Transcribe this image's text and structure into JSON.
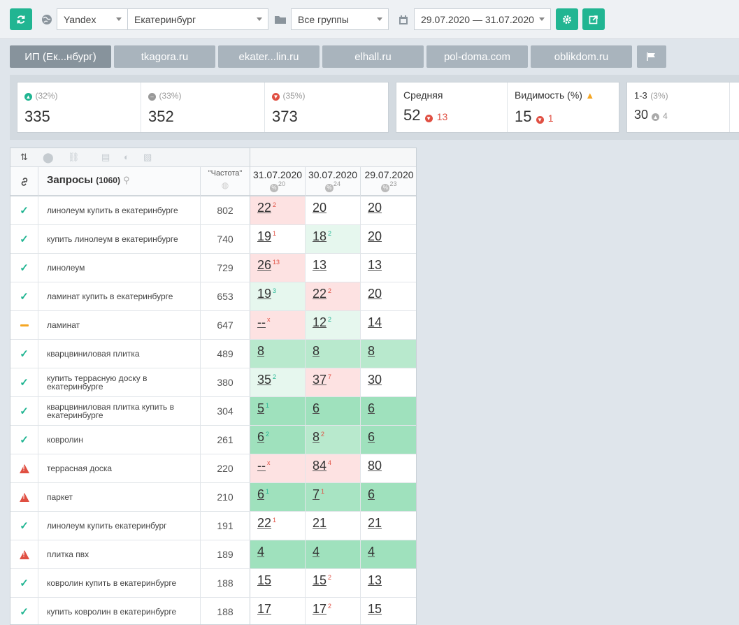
{
  "toolbar": {
    "engine": "Yandex",
    "region": "Екатеринбург",
    "group": "Все группы",
    "dates": "29.07.2020 — 31.07.2020"
  },
  "tabs": [
    "ИП (Ек...нбург)",
    "tkagora.ru",
    "ekater...lin.ru",
    "elhall.ru",
    "pol-doma.com",
    "oblikdom.ru"
  ],
  "stats": {
    "up": {
      "pct": "(32%)",
      "val": "335"
    },
    "same": {
      "pct": "(33%)",
      "val": "352"
    },
    "down": {
      "pct": "(35%)",
      "val": "373"
    },
    "avg": {
      "label": "Средняя",
      "val": "52",
      "delta": "13"
    },
    "vis": {
      "label": "Видимость (%)",
      "val": "15",
      "delta": "1"
    },
    "top": {
      "label": "1-3",
      "pct": "(3%)",
      "val": "30",
      "delta": "4"
    }
  },
  "table": {
    "queries_label": "Запросы",
    "queries_count": "(1060)",
    "freq_label": "\"Частота\"",
    "dates": [
      {
        "d": "31.07.2020",
        "p": "20"
      },
      {
        "d": "30.07.2020",
        "p": "24"
      },
      {
        "d": "29.07.2020",
        "p": "23"
      }
    ],
    "rows": [
      {
        "s": "ok",
        "q": "линолеум купить в екатеринбурге",
        "f": "802",
        "c": [
          {
            "v": "22",
            "d": "2",
            "t": "r",
            "b": "bg-red"
          },
          {
            "v": "20",
            "d": "",
            "t": "",
            "b": ""
          },
          {
            "v": "20",
            "d": "",
            "t": "",
            "b": ""
          }
        ]
      },
      {
        "s": "ok",
        "q": "купить линолеум в екатеринбурге",
        "f": "740",
        "c": [
          {
            "v": "19",
            "d": "1",
            "t": "r",
            "b": ""
          },
          {
            "v": "18",
            "d": "2",
            "t": "g",
            "b": "bg-lg"
          },
          {
            "v": "20",
            "d": "",
            "t": "",
            "b": ""
          }
        ]
      },
      {
        "s": "ok",
        "q": "линолеум",
        "f": "729",
        "c": [
          {
            "v": "26",
            "d": "13",
            "t": "r",
            "b": "bg-red"
          },
          {
            "v": "13",
            "d": "",
            "t": "",
            "b": ""
          },
          {
            "v": "13",
            "d": "",
            "t": "",
            "b": ""
          }
        ]
      },
      {
        "s": "ok",
        "q": "ламинат купить в екатеринбурге",
        "f": "653",
        "c": [
          {
            "v": "19",
            "d": "3",
            "t": "g",
            "b": "bg-lg"
          },
          {
            "v": "22",
            "d": "2",
            "t": "r",
            "b": "bg-red"
          },
          {
            "v": "20",
            "d": "",
            "t": "",
            "b": ""
          }
        ]
      },
      {
        "s": "dash",
        "q": "ламинат",
        "f": "647",
        "c": [
          {
            "v": "--",
            "d": "x",
            "t": "r",
            "b": "bg-red"
          },
          {
            "v": "12",
            "d": "2",
            "t": "g",
            "b": "bg-lg"
          },
          {
            "v": "14",
            "d": "",
            "t": "",
            "b": ""
          }
        ]
      },
      {
        "s": "ok",
        "q": "кварцвиниловая плитка",
        "f": "489",
        "c": [
          {
            "v": "8",
            "d": "",
            "t": "",
            "b": "bg-g"
          },
          {
            "v": "8",
            "d": "",
            "t": "",
            "b": "bg-g"
          },
          {
            "v": "8",
            "d": "",
            "t": "",
            "b": "bg-g"
          }
        ]
      },
      {
        "s": "ok",
        "q": "купить террасную доску в екатеринбурге",
        "f": "380",
        "c": [
          {
            "v": "35",
            "d": "2",
            "t": "g",
            "b": "bg-lg"
          },
          {
            "v": "37",
            "d": "7",
            "t": "r",
            "b": "bg-red"
          },
          {
            "v": "30",
            "d": "",
            "t": "",
            "b": ""
          }
        ]
      },
      {
        "s": "ok",
        "q": "кварцвиниловая плитка купить в екатеринбурге",
        "f": "304",
        "c": [
          {
            "v": "5",
            "d": "1",
            "t": "g",
            "b": "bg-dg"
          },
          {
            "v": "6",
            "d": "",
            "t": "",
            "b": "bg-dg"
          },
          {
            "v": "6",
            "d": "",
            "t": "",
            "b": "bg-dg"
          }
        ]
      },
      {
        "s": "ok",
        "q": "ковролин",
        "f": "261",
        "c": [
          {
            "v": "6",
            "d": "2",
            "t": "g",
            "b": "bg-dg"
          },
          {
            "v": "8",
            "d": "2",
            "t": "r",
            "b": "bg-g"
          },
          {
            "v": "6",
            "d": "",
            "t": "",
            "b": "bg-dg"
          }
        ]
      },
      {
        "s": "warn",
        "q": "террасная доска",
        "f": "220",
        "c": [
          {
            "v": "--",
            "d": "x",
            "t": "r",
            "b": "bg-red"
          },
          {
            "v": "84",
            "d": "4",
            "t": "r",
            "b": "bg-red"
          },
          {
            "v": "80",
            "d": "",
            "t": "",
            "b": ""
          }
        ]
      },
      {
        "s": "warn",
        "q": "паркет",
        "f": "210",
        "c": [
          {
            "v": "6",
            "d": "1",
            "t": "g",
            "b": "bg-dg"
          },
          {
            "v": "7",
            "d": "1",
            "t": "r",
            "b": "bg-mg"
          },
          {
            "v": "6",
            "d": "",
            "t": "",
            "b": "bg-dg"
          }
        ]
      },
      {
        "s": "ok",
        "q": "линолеум купить екатеринбург",
        "f": "191",
        "c": [
          {
            "v": "22",
            "d": "1",
            "t": "r",
            "b": ""
          },
          {
            "v": "21",
            "d": "",
            "t": "",
            "b": ""
          },
          {
            "v": "21",
            "d": "",
            "t": "",
            "b": ""
          }
        ]
      },
      {
        "s": "warn",
        "q": "плитка пвх",
        "f": "189",
        "c": [
          {
            "v": "4",
            "d": "",
            "t": "",
            "b": "bg-dg"
          },
          {
            "v": "4",
            "d": "",
            "t": "",
            "b": "bg-dg"
          },
          {
            "v": "4",
            "d": "",
            "t": "",
            "b": "bg-dg"
          }
        ]
      },
      {
        "s": "ok",
        "q": "ковролин купить в екатеринбурге",
        "f": "188",
        "c": [
          {
            "v": "15",
            "d": "",
            "t": "",
            "b": ""
          },
          {
            "v": "15",
            "d": "2",
            "t": "r",
            "b": ""
          },
          {
            "v": "13",
            "d": "",
            "t": "",
            "b": ""
          }
        ]
      },
      {
        "s": "ok",
        "q": "купить ковролин в екатеринбурге",
        "f": "188",
        "c": [
          {
            "v": "17",
            "d": "",
            "t": "",
            "b": ""
          },
          {
            "v": "17",
            "d": "2",
            "t": "r",
            "b": ""
          },
          {
            "v": "15",
            "d": "",
            "t": "",
            "b": ""
          }
        ]
      }
    ]
  },
  "colors": {
    "accent": "#21b592",
    "red": "#e04f42",
    "warn": "#f5a623"
  }
}
